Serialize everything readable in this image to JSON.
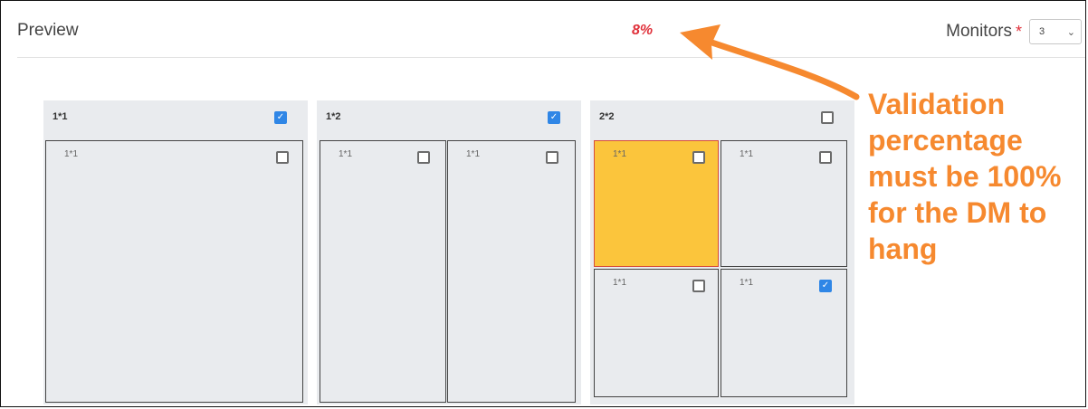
{
  "header": {
    "title": "Preview",
    "validation_percentage": "8%",
    "monitors_label": "Monitors",
    "required_mark": "*",
    "monitors_value": "3"
  },
  "layouts": [
    {
      "title": "1*1",
      "checked": true,
      "cells": [
        {
          "title": "1*1",
          "checked": false,
          "highlight": false
        }
      ]
    },
    {
      "title": "1*2",
      "checked": true,
      "cells": [
        {
          "title": "1*1",
          "checked": false,
          "highlight": false
        },
        {
          "title": "1*1",
          "checked": false,
          "highlight": false
        }
      ]
    },
    {
      "title": "2*2",
      "checked": false,
      "cells": [
        {
          "title": "1*1",
          "checked": false,
          "highlight": true
        },
        {
          "title": "1*1",
          "checked": false,
          "highlight": false
        },
        {
          "title": "1*1",
          "checked": false,
          "highlight": false
        },
        {
          "title": "1*1",
          "checked": true,
          "highlight": false
        }
      ]
    }
  ],
  "annotation": {
    "text": "Validation percentage must be 100% for the DM to hang",
    "color": "#f6892f"
  },
  "colors": {
    "highlight_cell": "#fbc53c",
    "highlight_border": "#d64b3b",
    "checkbox_checked": "#2f86e6",
    "percentage": "#e0303a"
  },
  "icons": {
    "checked": "check-icon",
    "select": "chevron-down-icon",
    "annotation": "arrow-icon"
  }
}
